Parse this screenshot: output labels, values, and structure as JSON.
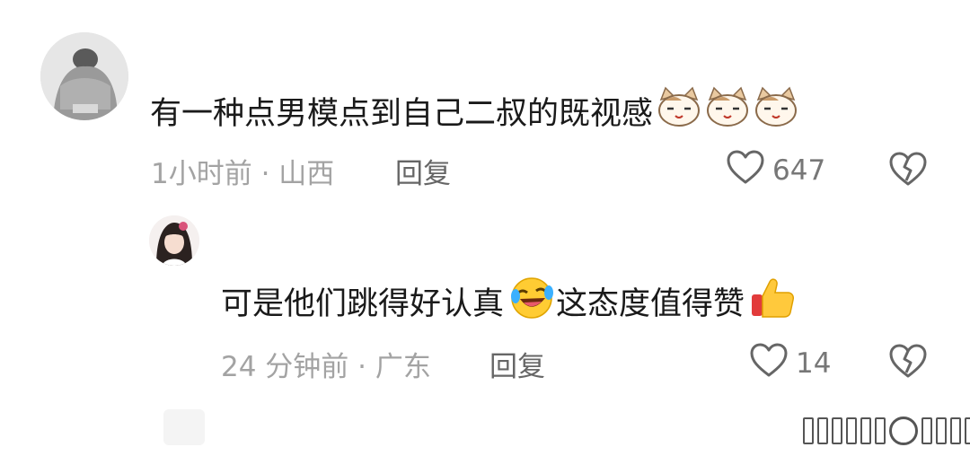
{
  "comments": [
    {
      "text": "有一种点男模点到自己二叔的既视感",
      "emoji_count": 3,
      "meta": "1小时前 · 山西",
      "reply_label": "回复",
      "likes": "647"
    },
    {
      "text_part1": "可是他们跳得好认真",
      "text_part2": "这态度值得赞",
      "meta": "24 分钟前 · 广东",
      "reply_label": "回复",
      "likes": "14"
    }
  ],
  "icons": {
    "like": "heart-outline-icon",
    "dislike": "broken-heart-icon",
    "emoji_cat": "cat-face-emoji",
    "emoji_laugh": "rolling-laugh-emoji",
    "emoji_thumb": "thumbs-up-emoji"
  }
}
